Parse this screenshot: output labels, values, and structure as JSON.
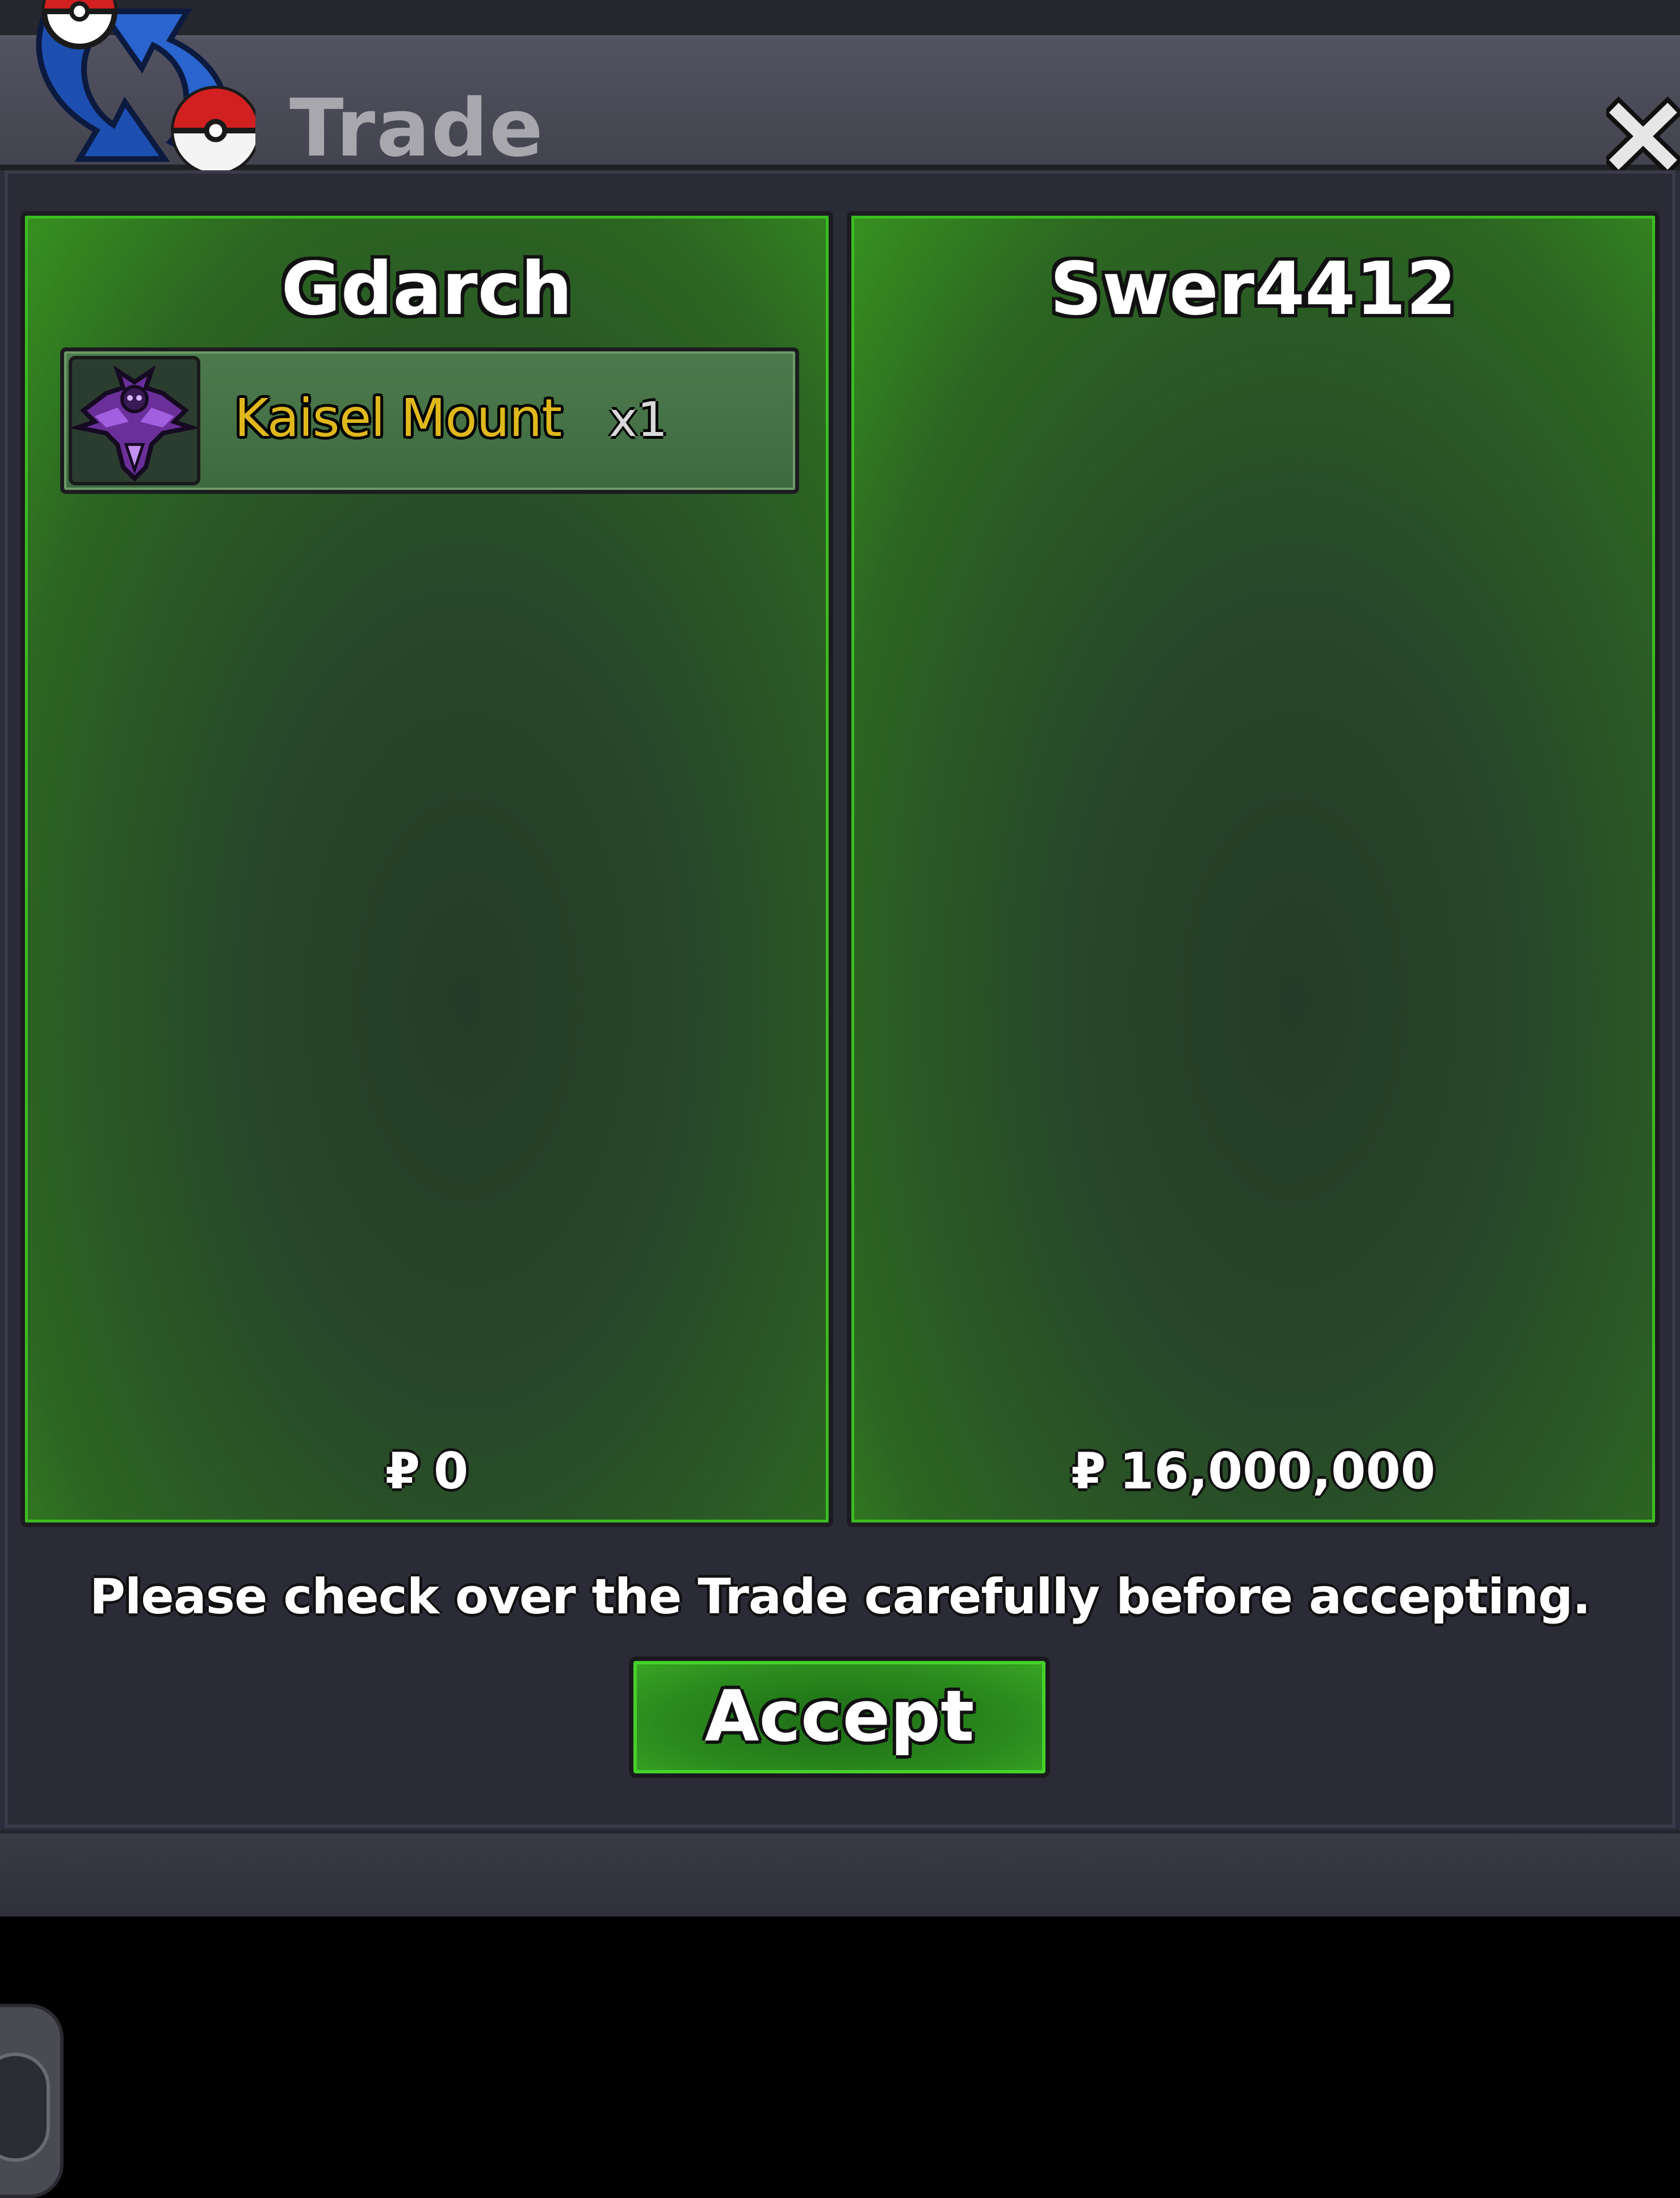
{
  "window": {
    "title": "Trade",
    "close_symbol": "✕"
  },
  "left_panel": {
    "player_name": "Gdarch",
    "items": [
      {
        "name": "Kaisel Mount",
        "quantity": "x1",
        "icon": "kaisel-mount-icon"
      }
    ],
    "currency_symbol": "₽",
    "money": "0"
  },
  "right_panel": {
    "player_name": "Swer4412",
    "items": [],
    "currency_symbol": "₽",
    "money": "16,000,000"
  },
  "notice": "Please check over the Trade carefully before accepting.",
  "accept_button": {
    "label": "Accept"
  },
  "colors": {
    "panel_green": "#36921f",
    "item_name_gold": "#e0b81c",
    "titlebar": "#4a4a58"
  }
}
